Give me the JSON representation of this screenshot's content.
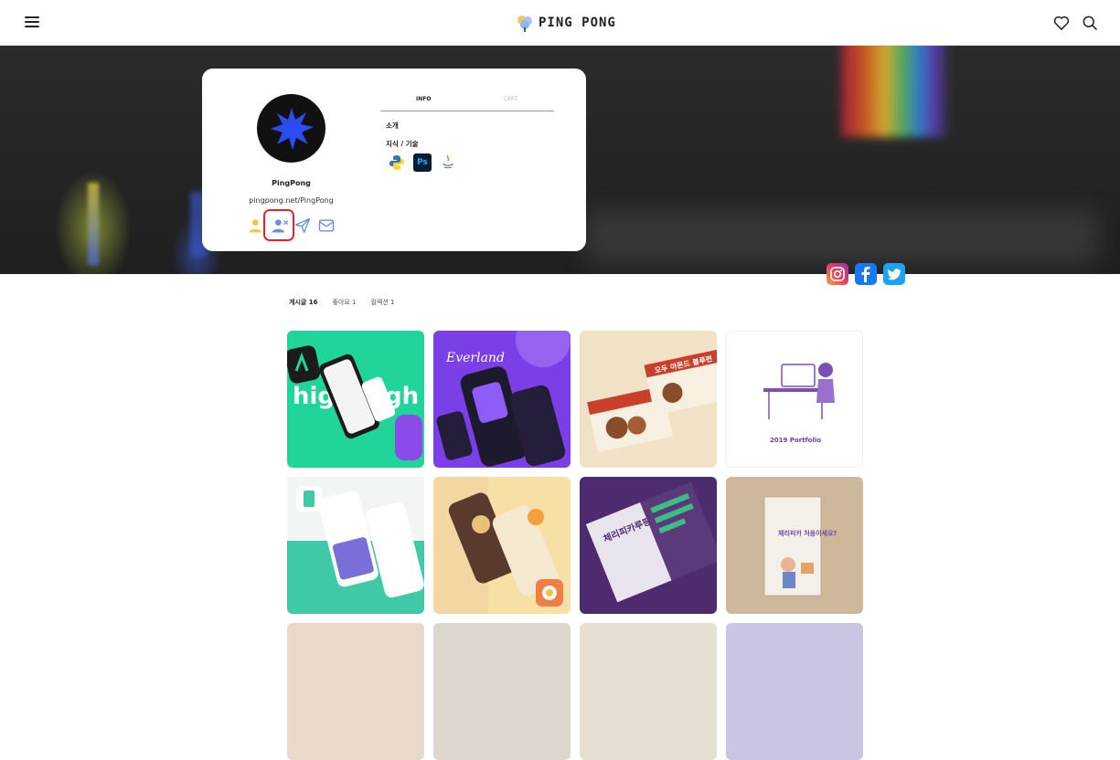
{
  "header": {
    "brand": "PING PONG",
    "icons": [
      "menu-icon",
      "heart-icon",
      "search-icon"
    ]
  },
  "profile": {
    "name": "PingPong",
    "url": "pingpong.net/PingPong",
    "tabs": [
      {
        "label": "INFO",
        "active": true
      },
      {
        "label": "CERT",
        "active": false
      }
    ],
    "intro_label": "소개",
    "skills_label": "지식 / 기술",
    "skills": [
      {
        "name": "python",
        "icon": "python-icon"
      },
      {
        "name": "Ps",
        "icon": "photoshop-icon"
      },
      {
        "name": "Java",
        "icon": "java-icon"
      }
    ],
    "actions": [
      "person-icon",
      "remove-person-icon",
      "send-icon",
      "mail-icon"
    ]
  },
  "socials": [
    "instagram-icon",
    "facebook-icon",
    "twitter-icon"
  ],
  "content_tabs": [
    {
      "label": "게시글 16",
      "active": true
    },
    {
      "label": "좋아요 1",
      "active": false
    },
    {
      "label": "컬렉션 1",
      "active": false
    }
  ],
  "posts": [
    {
      "title": "high high",
      "bg": "#21d49a"
    },
    {
      "title": "Everland",
      "bg": "#7a3fe6"
    },
    {
      "title": "오두 아몬드 블루펀",
      "bg": "#f1e1c6"
    },
    {
      "title": "2019 Portfolio",
      "bg": "#ffffff"
    },
    {
      "title": "",
      "bg": "#3fc9a6"
    },
    {
      "title": "",
      "bg": "#f6e0a6"
    },
    {
      "title": "체리피카루팡프로",
      "bg": "#4d2b6e"
    },
    {
      "title": "체리피카 처음이세요?",
      "bg": "#cdb89b"
    }
  ],
  "colors": {
    "accent_red": "#e0252b",
    "icon_blue": "#6a8fe0"
  }
}
